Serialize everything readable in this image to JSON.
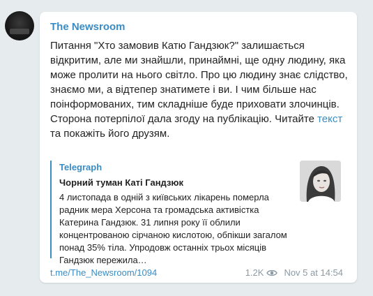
{
  "channel": {
    "name": "The Newsroom"
  },
  "message": {
    "text_before_link": "Питання \"Хто замовив Катю Гандзюк?\" залишається відкритим, але ми знайшли, принаймні, ще одну людину, яка може пролити на нього світло. Про цю людину знає слідство, знаємо ми, а відтепер знатимете і ви. І чим більше нас поінформованих, тим складніше буде приховати злочинців. Сторона потерпілої дала згоду на публікацію. Читайте ",
    "link_text": "текст",
    "text_after_link": " та покажіть його друзям."
  },
  "preview": {
    "site": "Telegraph",
    "title": "Чорний туман Каті Гандзюк",
    "description": "4 листопада в одній з київських лікарень померла радник мера Херсона та громадська активістка Катерина Гандзюк. 31 липня року її облили концентрованою сірчаною кислотою, обпікши загалом понад 35% тіла. Упродовж останніх трьох місяців Гандзюк пережила…"
  },
  "footer": {
    "post_link": "t.me/The_Newsroom/1094",
    "views": "1.2K",
    "views_icon": "eye-icon",
    "timestamp": "Nov 5 at 14:54"
  },
  "colors": {
    "accent": "#3a8cc4",
    "background": "#e6ebee",
    "text": "#222222",
    "meta": "#8b9aa5"
  }
}
